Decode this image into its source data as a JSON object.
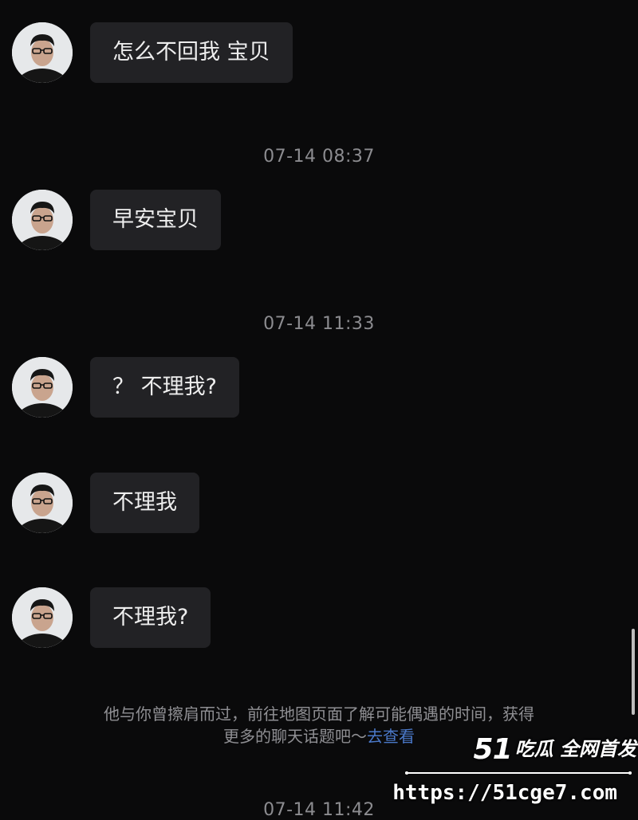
{
  "chat": {
    "messages": [
      {
        "text": "怎么不回我 宝贝"
      },
      {
        "text": "早安宝贝"
      },
      {
        "text": "？ 不理我?"
      },
      {
        "text": "不理我"
      },
      {
        "text": "不理我?"
      }
    ],
    "timestamps": [
      "07-14 08:37",
      "07-14 11:33",
      "07-14 11:42"
    ],
    "notice": {
      "line1": "他与你曾擦肩而过，前往地图页面了解可能偶遇的时间，获得",
      "line2": "更多的聊天话题吧～",
      "link": "去查看"
    }
  },
  "watermark": {
    "brand_number": "51",
    "brand_text": "吃瓜 全网首发",
    "url": "https://51cge7.com"
  },
  "colors": {
    "background": "#0a0a0b",
    "bubble": "#222225",
    "link": "#4a78c8"
  }
}
